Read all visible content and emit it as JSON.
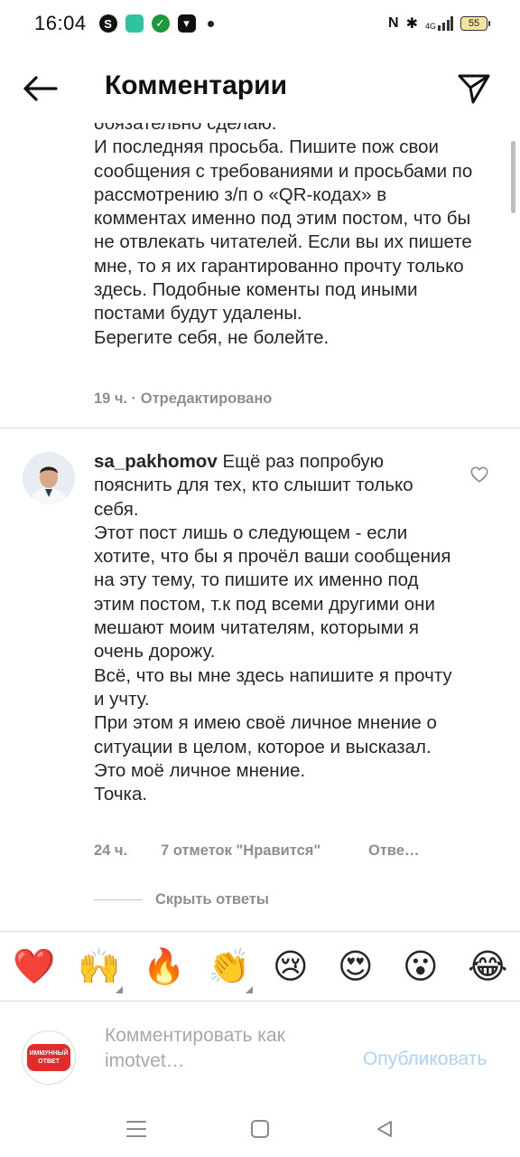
{
  "status_bar": {
    "time": "16:04",
    "left_icons": [
      "skype-icon",
      "app-icon",
      "sber-icon",
      "tinkoff-icon"
    ],
    "network": "4G",
    "battery": "55"
  },
  "header": {
    "title": "Комментарии"
  },
  "caption": {
    "text": "обязательно сделаю.\nИ последняя просьба. Пишите пож свои сообщения с требованиями и просьбами по рассмотрению з/п о «QR-кодах» в комментах именно под этим постом, что бы не отвлекать читателей. Если вы их пишете мне, то я их гарантированно прочту только здесь. Подобные коменты под иными постами будут удалены.\nБерегите себя, не болейте.",
    "meta": "19 ч. · Отредактировано"
  },
  "comment": {
    "username": "sa_pakhomov",
    "text": "Ещё раз попробую пояснить для тех, кто слышит только себя.\nЭтот пост лишь о следующем - если хотите, что бы я прочёл ваши сообщения на эту тему, то пишите их именно под этим постом, т.к под всеми другими они мешают моим читателям, которыми я очень дорожу.\nВсё, что вы мне здесь напишите я прочту и учту.\nПри этом я имею своё личное мнение о ситуации в целом, которое и высказал. Это моё личное мнение.\nТочка.",
    "time": "24 ч.",
    "likes": "7 отметок \"Нравится\"",
    "reply": "Отве…",
    "hide_replies": "Скрыть ответы"
  },
  "emoji_bar": [
    "❤️",
    "🙌",
    "🔥",
    "👏",
    "😢",
    "😍",
    "😮",
    "😂"
  ],
  "input": {
    "placeholder": "Комментировать как\nimotvet…",
    "publish": "Опубликовать",
    "brand_badge": "ИММУННЫЙ ОТВЕТ"
  },
  "colors": {
    "accent_publish": "#a8d4fb",
    "meta_gray": "#8e8e8e",
    "brand_red": "#e32b2b"
  }
}
